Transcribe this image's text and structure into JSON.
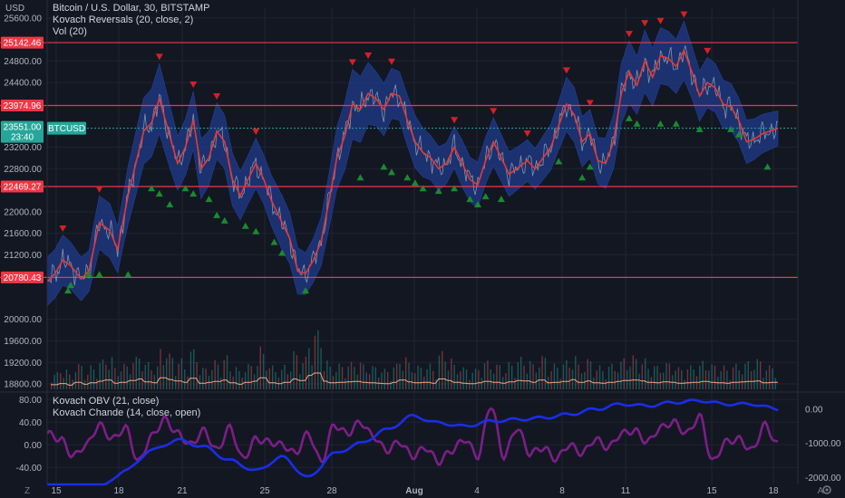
{
  "legend": {
    "title": "Bitcoin / U.S. Dollar, 30, BITSTAMP",
    "indicator1": "Kovach Reversals (20, close, 2)",
    "indicator2": "Vol (20)",
    "indicator3": "Kovach OBV (21, close)",
    "indicator4": "Kovach Chande (14, close, open)"
  },
  "axis": {
    "currency": "USD",
    "z_label": "Z",
    "a_label": "A",
    "gear_icon": "gear-icon",
    "main_ticks": [
      "25600.00",
      "24800.00",
      "24400.00",
      "23200.00",
      "22800.00",
      "22000.00",
      "21600.00",
      "21200.00",
      "20000.00",
      "19600.00",
      "19200.00",
      "18800.00"
    ],
    "main_tick_values": [
      25600,
      24800,
      24400,
      23200,
      22800,
      22000,
      21600,
      21200,
      20000,
      19600,
      19200,
      18800
    ],
    "sub_left_ticks": [
      "80.00",
      "40.00",
      "0.00",
      "-40.00"
    ],
    "sub_left_values": [
      80,
      40,
      0,
      -40
    ],
    "sub_right_ticks": [
      "0.00",
      "-1000.00",
      "-2000.00"
    ],
    "sub_right_values": [
      0,
      -1000,
      -2000
    ],
    "x_ticks": [
      "15",
      "18",
      "21",
      "25",
      "28",
      "Aug",
      "4",
      "8",
      "11",
      "15",
      "18"
    ]
  },
  "levels": [
    {
      "label": "25142.46",
      "value": 25142.46
    },
    {
      "label": "23974.96",
      "value": 23974.96
    },
    {
      "label": "22469.27",
      "value": 22469.27
    },
    {
      "label": "20780.43",
      "value": 20780.43
    }
  ],
  "current": {
    "symbol": "BTCUSD",
    "price_label": "23551.00",
    "countdown": "23:40",
    "value": 23551
  },
  "colors": {
    "background": "#131722",
    "grid": "#1f2433",
    "axis_text": "#b2b5be",
    "level_line": "#f23645",
    "level_label_bg": "#f23645",
    "current_bg": "#26a69a",
    "band": "#1e3a8a",
    "band_edge": "#2a4fc2",
    "price": "#9aa4b0",
    "signal_line": "#e53935",
    "up_marker": "#1b8a2f",
    "down_marker": "#d3202a",
    "volume_up": "#26a69a",
    "volume_down": "#ef5350",
    "volume_ma": "#f4a582",
    "obv": "#1a2ee8",
    "chande": "#7b1f86"
  },
  "chart_data": [
    {
      "type": "line",
      "name": "main-price",
      "xlabel": "",
      "ylabel": "",
      "ylim": [
        18700,
        25800
      ],
      "x": [
        0,
        3,
        6,
        9,
        13,
        16,
        18,
        20,
        24,
        27,
        29,
        31,
        34,
        37,
        40,
        43,
        47,
        50,
        53,
        56,
        59,
        62,
        65,
        68,
        71,
        74,
        77,
        80,
        83,
        86,
        90,
        93,
        96,
        99,
        102,
        105,
        108,
        111,
        114,
        117,
        120,
        123,
        126,
        129,
        132,
        135,
        138,
        141,
        144,
        147,
        150,
        153,
        156,
        159,
        162,
        165,
        168,
        171,
        174,
        177,
        180,
        184,
        187,
        190,
        193,
        196,
        199,
        202,
        205,
        208,
        211,
        214,
        217,
        220,
        223,
        226,
        229,
        232,
        235,
        238,
        241,
        244,
        247,
        250,
        253,
        256,
        259,
        262,
        265,
        268,
        271,
        274,
        277,
        280
      ],
      "y": [
        20700,
        20850,
        21100,
        21000,
        20750,
        20900,
        21350,
        21800,
        21650,
        21300,
        21800,
        22300,
        22900,
        23500,
        23650,
        24100,
        23400,
        22900,
        23200,
        23700,
        22800,
        23000,
        23500,
        23300,
        22600,
        22300,
        22600,
        22900,
        22600,
        22200,
        21800,
        21500,
        20900,
        20850,
        21100,
        21450,
        22200,
        23000,
        23400,
        24000,
        23900,
        24200,
        24100,
        23900,
        24200,
        24150,
        23700,
        23300,
        23100,
        23000,
        22800,
        22900,
        23200,
        22900,
        22600,
        22500,
        22950,
        23300,
        23000,
        22700,
        22800,
        22950,
        22800,
        23000,
        23200,
        23600,
        24000,
        23800,
        23300,
        23450,
        22950,
        22900,
        23300,
        24200,
        24600,
        24350,
        24800,
        24500,
        24900,
        24850,
        24700,
        25000,
        24600,
        24150,
        24400,
        24300,
        24000,
        23950,
        23700,
        23300,
        23350,
        23450,
        23500,
        23551
      ],
      "band_width": [
        500,
        500,
        520,
        480,
        450,
        420,
        500,
        550,
        560,
        480,
        520,
        600,
        650,
        680,
        700,
        720,
        650,
        560,
        580,
        600,
        620,
        560,
        580,
        550,
        540,
        500,
        500,
        520,
        500,
        520,
        560,
        520,
        480,
        430,
        450,
        500,
        560,
        640,
        700,
        720,
        680,
        640,
        560,
        540,
        520,
        500,
        520,
        540,
        500,
        460,
        450,
        420,
        430,
        480,
        460,
        470,
        480,
        500,
        480,
        460,
        440,
        430,
        420,
        450,
        470,
        500,
        560,
        560,
        520,
        500,
        480,
        520,
        560,
        620,
        640,
        600,
        640,
        600,
        580,
        560,
        560,
        600,
        540,
        520,
        520,
        500,
        500,
        480,
        460,
        450,
        420,
        400,
        380,
        360
      ],
      "up_signals_x": [
        8,
        9,
        16,
        20,
        31,
        40,
        43,
        47,
        53,
        56,
        62,
        65,
        68,
        76,
        80,
        87,
        90,
        99,
        120,
        129,
        132,
        138,
        141,
        144,
        150,
        156,
        162,
        165,
        168,
        174,
        196,
        205,
        208,
        223,
        226,
        235,
        241,
        250,
        262,
        265,
        276
      ],
      "up_signals_y": [
        20700,
        20800,
        21000,
        21000,
        21000,
        22600,
        22500,
        22300,
        22600,
        22500,
        22400,
        22100,
        22000,
        21900,
        21800,
        21600,
        21400,
        20700,
        22800,
        23000,
        22900,
        22800,
        22700,
        22600,
        22550,
        22600,
        22400,
        22300,
        22450,
        22400,
        23100,
        22800,
        23000,
        23900,
        23800,
        23800,
        23800,
        23700,
        23700,
        23600,
        23000
      ]
    },
    {
      "type": "bar",
      "name": "volume",
      "ylim": [
        0,
        100
      ],
      "values": [
        20,
        25,
        18,
        30,
        22,
        28,
        35,
        40,
        26,
        30,
        38,
        45,
        32,
        28,
        50,
        42,
        36,
        30,
        48,
        26,
        30,
        34,
        40,
        28,
        22,
        30,
        35,
        50,
        28,
        24,
        30,
        45,
        38,
        60,
        70,
        35,
        28,
        30,
        32,
        34,
        30,
        28,
        26,
        24,
        30,
        40,
        32,
        28,
        30,
        26,
        45,
        38,
        30,
        26,
        24,
        28,
        34,
        30,
        26,
        32,
        38,
        36,
        30,
        40,
        28,
        30,
        34,
        42,
        30,
        36,
        28,
        26,
        30,
        34,
        38,
        40,
        36,
        30,
        28,
        32,
        30,
        26,
        28,
        30,
        34,
        30,
        28,
        26,
        30,
        32,
        34,
        36,
        28,
        30
      ]
    },
    {
      "type": "line",
      "name": "kovach-obv",
      "ylim": [
        -2200,
        450
      ],
      "x": [
        0,
        10,
        20,
        30,
        40,
        50,
        60,
        70,
        80,
        90,
        100,
        110,
        120,
        130,
        140,
        150,
        160,
        170,
        180,
        190,
        200,
        210,
        220,
        230,
        240,
        250,
        260,
        270,
        280
      ],
      "y": [
        -2500,
        -2400,
        -2300,
        -1800,
        -1200,
        -900,
        -1100,
        -1500,
        -1800,
        -1400,
        -2000,
        -1300,
        -1000,
        -600,
        -200,
        -400,
        -500,
        -350,
        -300,
        -250,
        -150,
        0,
        150,
        100,
        200,
        250,
        150,
        150,
        0
      ]
    },
    {
      "type": "line",
      "name": "kovach-chande",
      "ylim": [
        -70,
        90
      ],
      "x": [
        0,
        5,
        10,
        15,
        20,
        25,
        30,
        35,
        40,
        45,
        50,
        55,
        60,
        65,
        70,
        75,
        80,
        85,
        90,
        95,
        100,
        105,
        110,
        115,
        120,
        125,
        130,
        135,
        140,
        145,
        150,
        155,
        160,
        165,
        170,
        175,
        180,
        185,
        190,
        195,
        200,
        205,
        210,
        215,
        220,
        225,
        230,
        235,
        240,
        245,
        250,
        255,
        260,
        265,
        270,
        275,
        280
      ],
      "y": [
        20,
        10,
        -20,
        0,
        35,
        10,
        30,
        -30,
        15,
        45,
        20,
        0,
        25,
        -10,
        30,
        -25,
        10,
        5,
        0,
        -15,
        20,
        -30,
        35,
        20,
        40,
        15,
        -10,
        5,
        -20,
        -5,
        -30,
        -10,
        10,
        -20,
        70,
        -20,
        30,
        -15,
        -5,
        -25,
        0,
        -15,
        10,
        -5,
        20,
        25,
        5,
        30,
        40,
        20,
        50,
        -30,
        5,
        10,
        -10,
        35,
        0
      ]
    }
  ]
}
